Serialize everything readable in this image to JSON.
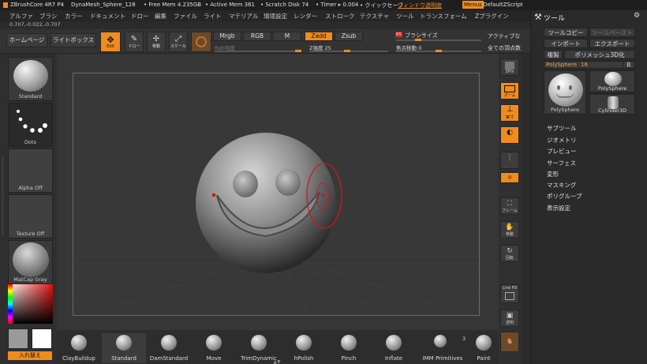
{
  "titlebar": {
    "app": "ZBrushCore 4R7 P4",
    "file": "DynaMesh_Sphere_128",
    "free_mem": "• Free Mem 4.235GB",
    "active_mem": "• Active Mem 361",
    "scratch": "• Scratch Disk 74",
    "timer": "• Timer ▸ 0.004",
    "quicksave": "• クイックセーブ",
    "transparency": "ウィンドウ透明度",
    "menus": "Menus",
    "script": "DefaultZScript"
  },
  "menubar": [
    "アルファ",
    "ブラシ",
    "カラー",
    "ドキュメント",
    "ドロー",
    "編集",
    "ファイル",
    "ライト",
    "マテリアル",
    "環境設定",
    "レンダー",
    "ストローク",
    "テクスチャ",
    "ツール",
    "トランスフォーム",
    "Zプラグイン"
  ],
  "coords": "0.707,-0.022,-0.707",
  "toolbar": {
    "home": "ホームページ",
    "lightbox": "ライトボックス",
    "edit": "Edit",
    "draw": "ドロー",
    "move": "移動",
    "scale": "スケール",
    "rotate": "回転",
    "mrgb": "Mrgb",
    "rgb": "RGB",
    "m": "M",
    "zadd": "Zadd",
    "zsub": "Zsub",
    "rgb_intensity": "Rgb強度",
    "z_intensity": "Z強度 25",
    "brush_size_badge": "65",
    "brush_size": "ブラシサイズ",
    "focal_shift": "焦点移動 0",
    "active": "アクティブな",
    "total": "全ての頂点数"
  },
  "left_shelf": {
    "brush": "Standard",
    "stroke": "Dots",
    "alpha": "Alpha Off",
    "texture": "Texture Off",
    "material": "MatCap Gray",
    "swap": "入れ替え"
  },
  "right_shelf": [
    "SPix",
    "ズーム",
    "実寸",
    "フレーム",
    "移動",
    "回転",
    "Line Fill",
    "透明"
  ],
  "right_panel": {
    "title": "ツール",
    "copy_tool": "ツールコピー",
    "paste_tool": "ツールペースト",
    "import": "インポート",
    "export": "エクスポート",
    "clone": "複製",
    "polymesh": "ポリメッシュ3D化",
    "polysphere_label": "PolySphere",
    "polysphere_count": "16",
    "r_button": "R",
    "thumb_main": "PolySphere",
    "thumb_small1": "PolySphere",
    "thumb_small2": "Cylinder3D",
    "subtools": [
      "サブツール",
      "ジオメトリ",
      "プレビュー",
      "サーフェス",
      "変形",
      "マスキング",
      "ポリグループ",
      "表示設定"
    ]
  },
  "bottom_shelf": [
    "ClayBuildup",
    "Standard",
    "DamStandard",
    "Move",
    "TrimDynamic",
    "hPolish",
    "Pinch",
    "Inflate",
    "IMM Primitives",
    "Paint"
  ],
  "bottom_badge": "3",
  "colors": {
    "accent": "#f08c1e",
    "bg": "#2b2b2b"
  }
}
